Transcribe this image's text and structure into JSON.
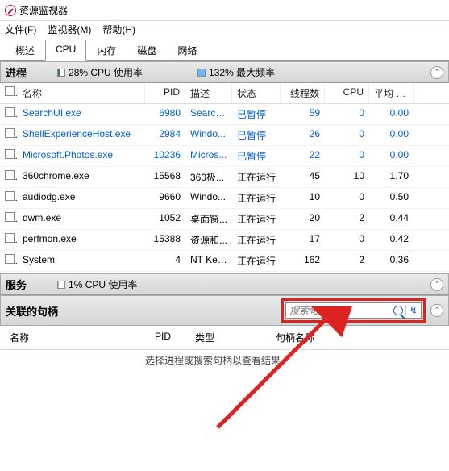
{
  "window": {
    "title": "资源监视器"
  },
  "menu": {
    "file": "文件(F)",
    "monitor": "监视器(M)",
    "help": "帮助(H)"
  },
  "tabs": {
    "overview": "概述",
    "cpu": "CPU",
    "memory": "内存",
    "disk": "磁盘",
    "network": "网络"
  },
  "processes": {
    "title": "进程",
    "cpu_usage": "28% CPU 使用率",
    "max_freq": "132% 最大频率",
    "columns": {
      "name": "名称",
      "pid": "PID",
      "desc": "描述",
      "status": "状态",
      "threads": "线程数",
      "cpu": "CPU",
      "avg": "平均 C..."
    },
    "rows": [
      {
        "name": "SearchUI.exe",
        "pid": "6980",
        "desc": "Search...",
        "status": "已暂停",
        "threads": "59",
        "cpu": "0",
        "avg": "0.00",
        "blue": true
      },
      {
        "name": "ShellExperienceHost.exe",
        "pid": "2984",
        "desc": "Windo...",
        "status": "已暂停",
        "threads": "26",
        "cpu": "0",
        "avg": "0.00",
        "blue": true
      },
      {
        "name": "Microsoft.Photos.exe",
        "pid": "10236",
        "desc": "Micros...",
        "status": "已暂停",
        "threads": "22",
        "cpu": "0",
        "avg": "0.00",
        "blue": true
      },
      {
        "name": "360chrome.exe",
        "pid": "15568",
        "desc": "360极...",
        "status": "正在运行",
        "threads": "45",
        "cpu": "10",
        "avg": "1.70",
        "blue": false
      },
      {
        "name": "audiodg.exe",
        "pid": "9660",
        "desc": "Windo...",
        "status": "正在运行",
        "threads": "10",
        "cpu": "0",
        "avg": "0.50",
        "blue": false
      },
      {
        "name": "dwm.exe",
        "pid": "1052",
        "desc": "桌面窗...",
        "status": "正在运行",
        "threads": "20",
        "cpu": "2",
        "avg": "0.44",
        "blue": false
      },
      {
        "name": "perfmon.exe",
        "pid": "15388",
        "desc": "资源和...",
        "status": "正在运行",
        "threads": "17",
        "cpu": "0",
        "avg": "0.42",
        "blue": false
      },
      {
        "name": "System",
        "pid": "4",
        "desc": "NT Ker...",
        "status": "正在运行",
        "threads": "162",
        "cpu": "2",
        "avg": "0.36",
        "blue": false
      }
    ]
  },
  "services": {
    "title": "服务",
    "cpu_usage": "1% CPU 使用率"
  },
  "handles": {
    "title": "关联的句柄",
    "search_placeholder": "搜索句柄",
    "columns": {
      "name": "名称",
      "pid": "PID",
      "type": "类型",
      "handle_name": "句柄名称"
    },
    "empty_msg": "选择进程或搜索句柄以查看结果。"
  }
}
